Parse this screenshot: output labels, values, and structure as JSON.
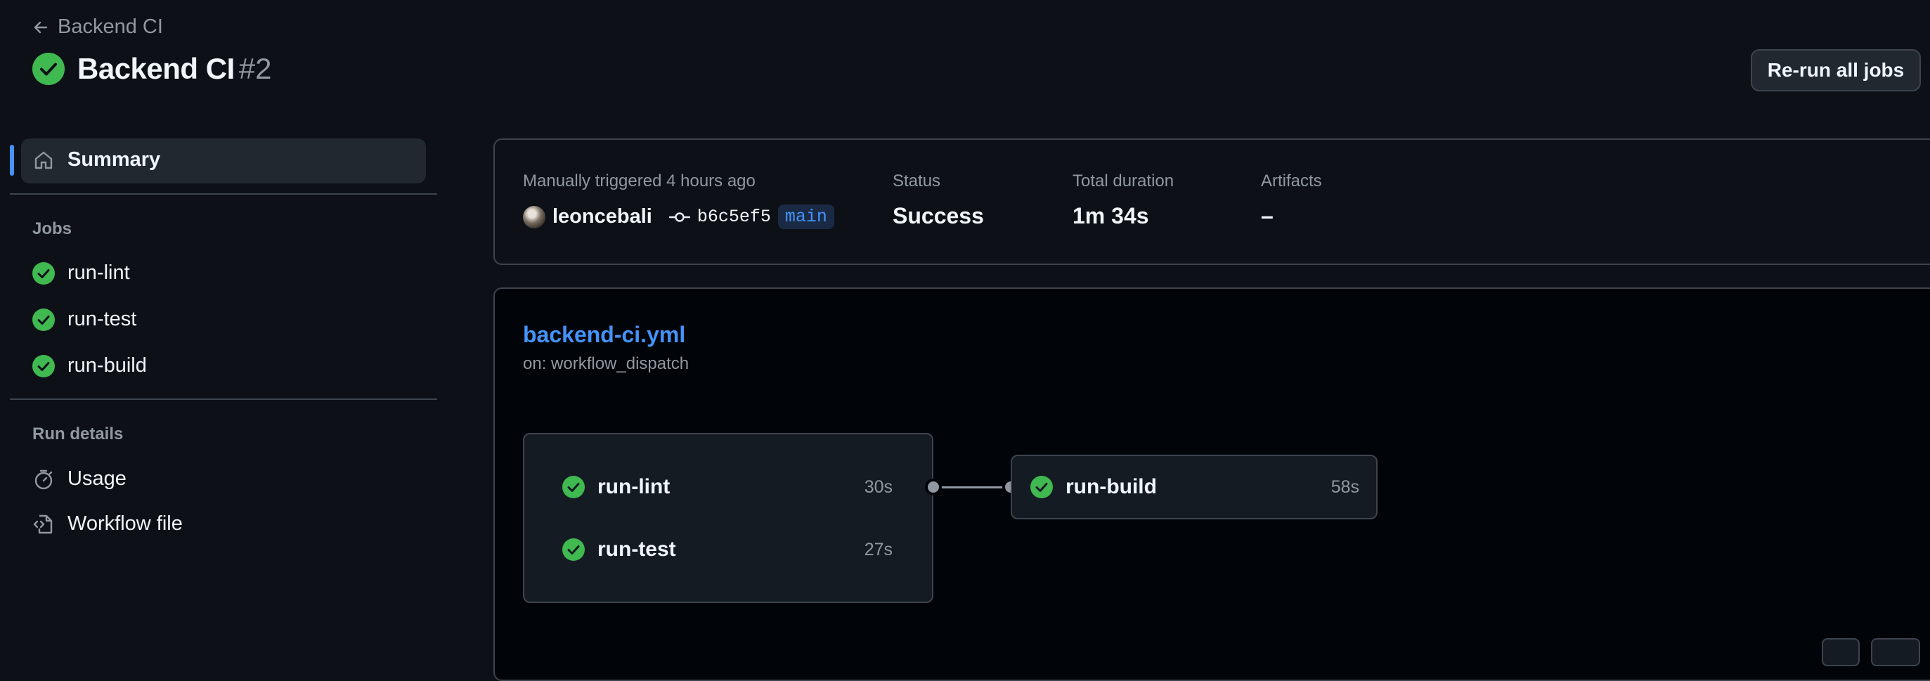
{
  "header": {
    "back_label": "Backend CI",
    "title": "Backend CI",
    "run_number": "#2",
    "rerun_label": "Re-run all jobs"
  },
  "sidebar": {
    "summary_label": "Summary",
    "jobs_heading": "Jobs",
    "jobs": [
      {
        "label": "run-lint",
        "status": "success"
      },
      {
        "label": "run-test",
        "status": "success"
      },
      {
        "label": "run-build",
        "status": "success"
      }
    ],
    "run_details_heading": "Run details",
    "details": [
      {
        "label": "Usage",
        "icon": "stopwatch-icon"
      },
      {
        "label": "Workflow file",
        "icon": "file-code-icon"
      }
    ]
  },
  "summary": {
    "trigger_text": "Manually triggered 4 hours ago",
    "actor": "leoncebali",
    "commit": "b6c5ef5",
    "branch": "main",
    "status_label": "Status",
    "status_value": "Success",
    "duration_label": "Total duration",
    "duration_value": "1m 34s",
    "artifacts_label": "Artifacts",
    "artifacts_value": "–"
  },
  "workflow": {
    "file": "backend-ci.yml",
    "trigger": "on: workflow_dispatch",
    "group_jobs": [
      {
        "name": "run-lint",
        "duration": "30s"
      },
      {
        "name": "run-test",
        "duration": "27s"
      }
    ],
    "downstream_job": {
      "name": "run-build",
      "duration": "58s"
    }
  },
  "colors": {
    "success": "#3fb950",
    "accent": "#4493f8",
    "background": "#0d1117"
  }
}
